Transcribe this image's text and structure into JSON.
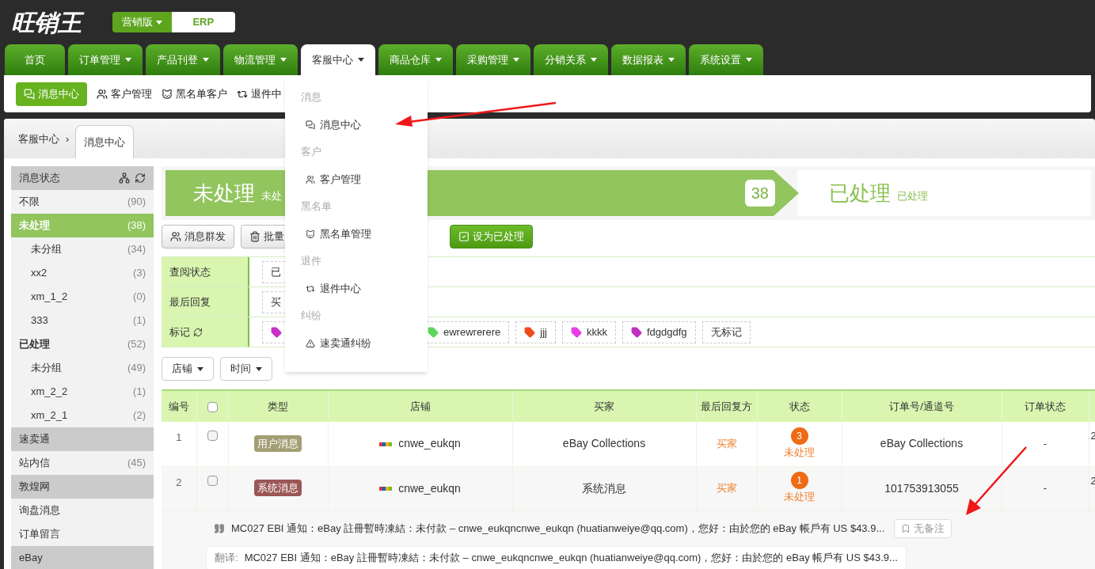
{
  "logo": "旺销王",
  "edition": {
    "label": "营销版",
    "erp": "ERP"
  },
  "nav": [
    {
      "label": "首页",
      "selected": false,
      "caret": false
    },
    {
      "label": "订单管理",
      "selected": false,
      "caret": true
    },
    {
      "label": "产品刊登",
      "selected": false,
      "caret": true
    },
    {
      "label": "物流管理",
      "selected": false,
      "caret": true
    },
    {
      "label": "客服中心",
      "selected": true,
      "caret": true
    },
    {
      "label": "商品仓库",
      "selected": false,
      "caret": true
    },
    {
      "label": "采购管理",
      "selected": false,
      "caret": true
    },
    {
      "label": "分销关系",
      "selected": false,
      "caret": true
    },
    {
      "label": "数据报表",
      "selected": false,
      "caret": true
    },
    {
      "label": "系统设置",
      "selected": false,
      "caret": true
    }
  ],
  "subnav": [
    {
      "label": "消息中心",
      "kind": "chat",
      "selected": true
    },
    {
      "label": "客户管理",
      "kind": "users",
      "selected": false
    },
    {
      "label": "黑名单客户",
      "kind": "cat",
      "selected": false
    },
    {
      "label": "退件中",
      "kind": "retweet",
      "selected": false
    }
  ],
  "dropdown": [
    {
      "title": "消息",
      "items": [
        {
          "label": "消息中心",
          "kind": "chat"
        }
      ]
    },
    {
      "title": "客户",
      "items": [
        {
          "label": "客户管理",
          "kind": "users"
        }
      ]
    },
    {
      "title": "黑名单",
      "items": [
        {
          "label": "黑名单管理",
          "kind": "cat"
        }
      ]
    },
    {
      "title": "退件",
      "items": [
        {
          "label": "退件中心",
          "kind": "retweet"
        }
      ]
    },
    {
      "title": "纠纷",
      "items": [
        {
          "label": "速卖通纠纷",
          "kind": "warning"
        }
      ]
    }
  ],
  "breadcrumb": {
    "root": "客服中心",
    "separator": "›",
    "current": "消息中心"
  },
  "sidebar": [
    {
      "title": "消息状态",
      "tools": true,
      "items": [
        {
          "label": "不限",
          "count": "(90)",
          "selected": false
        },
        {
          "label": "未处理",
          "count": "(38)",
          "selected": true,
          "children": [
            {
              "label": "未分组",
              "count": "(34)",
              "selected": false
            },
            {
              "label": "xx2",
              "count": "(3)",
              "selected": false
            },
            {
              "label": "xm_1_2",
              "count": "(0)",
              "selected": false
            },
            {
              "label": "333",
              "count": "(1)",
              "selected": false
            }
          ]
        },
        {
          "label": "已处理",
          "count": "(52)",
          "selected": false,
          "children": [
            {
              "label": "未分组",
              "count": "(49)",
              "selected": false
            },
            {
              "label": "xm_2_2",
              "count": "(1)",
              "selected": false
            },
            {
              "label": "xm_2_1",
              "count": "(2)",
              "selected": false
            }
          ]
        }
      ]
    },
    {
      "title": "速卖通",
      "tools": false,
      "items": [
        {
          "label": "站内信",
          "count": "(45)",
          "selected": false
        }
      ]
    },
    {
      "title": "敦煌网",
      "tools": false,
      "items": [
        {
          "label": "询盘消息",
          "selected": false
        },
        {
          "label": "订单留言",
          "selected": false
        }
      ]
    },
    {
      "title": "eBay",
      "tools": false
    }
  ],
  "banner": {
    "active": {
      "title": "未处理",
      "subtitle": "未处",
      "count": "38"
    },
    "other": {
      "title": "已处理",
      "subtitle": "已处理"
    }
  },
  "toolbar": [
    {
      "label": "消息群发",
      "kind": "users"
    },
    {
      "label": "批量",
      "kind": "trash"
    },
    {
      "label": "设为已处理",
      "kind": "primary"
    }
  ],
  "filters": [
    {
      "label": "查阅状态",
      "refresh": false,
      "options": [
        {
          "label": "已",
          "kind": "plain"
        }
      ]
    },
    {
      "label": "最后回复",
      "refresh": false,
      "options": [
        {
          "label": "买",
          "kind": "plain"
        }
      ]
    },
    {
      "label": "标记",
      "refresh": true,
      "options": [
        {
          "kind": "tag",
          "color": "#c830c8"
        },
        {
          "label": "ewrewrerere",
          "kind": "tag",
          "color": "#5cd65c"
        },
        {
          "label": "jjj",
          "kind": "tag",
          "color": "#f04a1d"
        },
        {
          "label": "kkkk",
          "kind": "tag",
          "color": "#e83ce8"
        },
        {
          "label": "fdgdgdfg",
          "kind": "tag",
          "color": "#c030c0"
        },
        {
          "label": "无标记",
          "kind": "plain"
        }
      ]
    }
  ],
  "selectors": [
    "店铺",
    "时间"
  ],
  "table": {
    "select_all_checked": false,
    "columns": [
      "编号",
      "类型",
      "店铺",
      "买家",
      "最后回复方",
      "状态",
      "订单号/通道号",
      "订单状态"
    ],
    "rows": [
      {
        "number": "1",
        "checked": false,
        "type": {
          "label": "用户消息",
          "color": "#a39e74"
        },
        "shop": "cnwe_eukqn",
        "buyer": "eBay Collections",
        "last_reply": "买家",
        "unread": "3",
        "status": "未处理",
        "order": "eBay Collections",
        "order_status": "-",
        "column_10": "2"
      },
      {
        "number": "2",
        "checked": false,
        "type": {
          "label": "系统消息",
          "color": "#9b5656"
        },
        "shop": "cnwe_eukqn",
        "buyer": "系统消息",
        "last_reply": "买家",
        "unread": "1",
        "status": "未处理",
        "order": "101753913055",
        "order_status": "-",
        "column_10": "2"
      }
    ]
  },
  "message": {
    "text": "MC027 EBI 通知：eBay 註冊暫時凍結：未付款 – cnwe_eukqncnwe_eukqn (huatianweiye@qq.com)，您好：由於您的 eBay 帳戶有 US $43.9...",
    "note": "无备注",
    "translation_label": "翻译:",
    "translation": "MC027 EBI 通知：eBay 註冊暫時凍結：未付款 – cnwe_eukqncnwe_eukqn (huatianweiye@qq.com)，您好：由於您的 eBay 帳戶有 US $43.9..."
  }
}
